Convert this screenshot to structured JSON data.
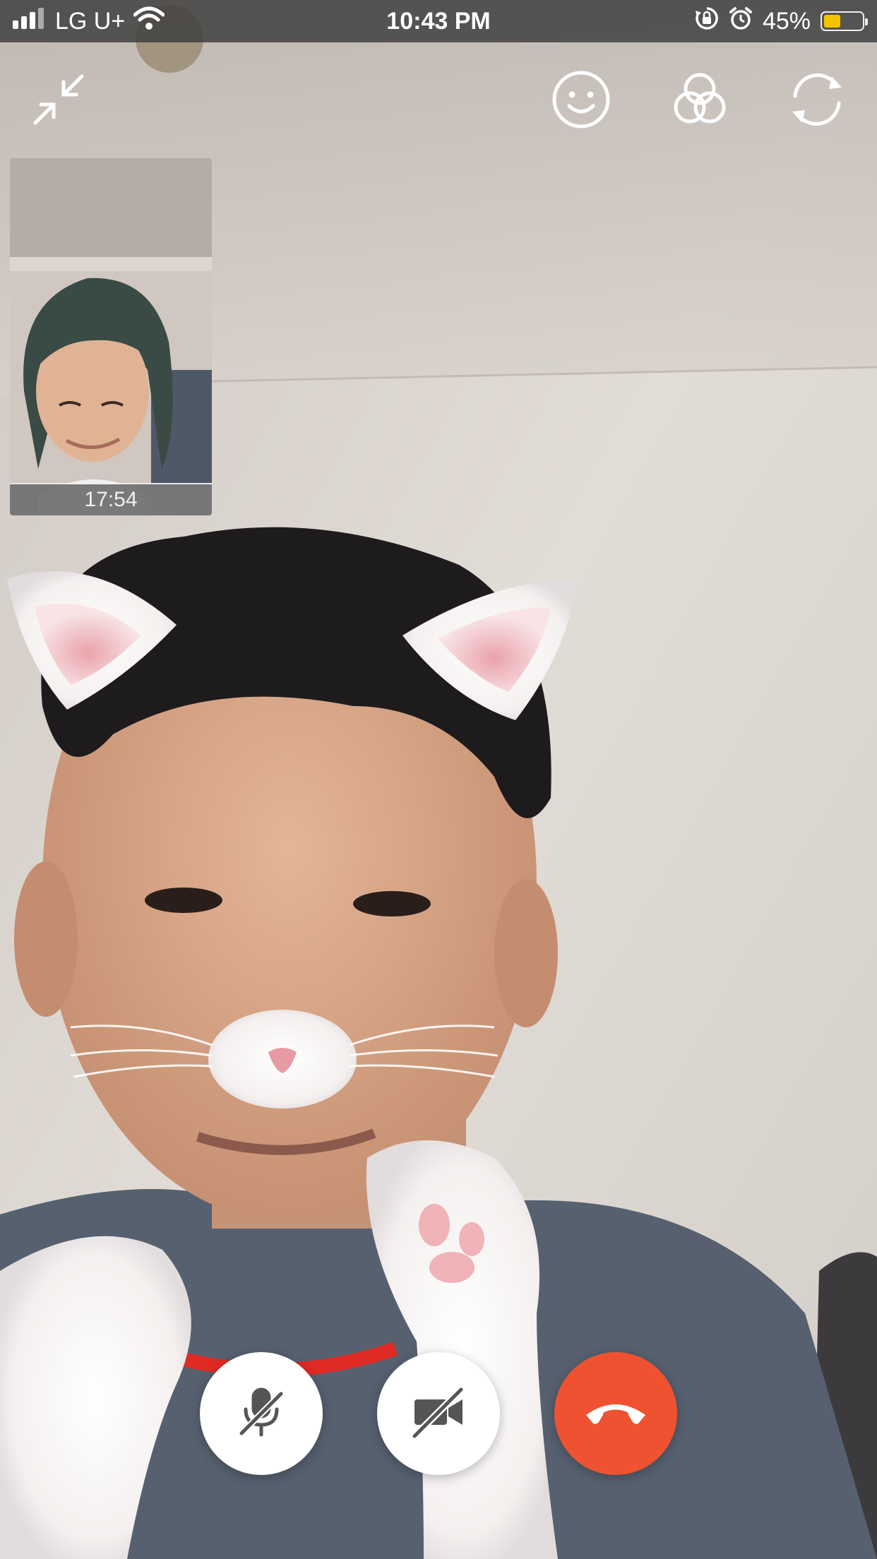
{
  "status_bar": {
    "carrier": "LG U+",
    "time": "10:43 PM",
    "battery_percent_label": "45%",
    "battery_level": 0.45,
    "signal_icon": "signal-bars-icon",
    "wifi_icon": "wifi-icon",
    "rotation_lock_icon": "rotation-lock-icon",
    "alarm_icon": "alarm-icon",
    "battery_icon": "battery-icon",
    "battery_color": "#f5c400"
  },
  "top_controls": {
    "minimize_icon": "minimize-arrows-icon",
    "effects_icon": "smiley-face-icon",
    "filters_icon": "filters-circles-icon",
    "switch_camera_icon": "switch-camera-icon"
  },
  "self_preview": {
    "call_duration": "17:54"
  },
  "bottom_controls": {
    "mute_icon": "microphone-off-icon",
    "video_off_icon": "video-camera-off-icon",
    "end_call_icon": "phone-hangup-icon",
    "end_call_color": "#ee5230"
  }
}
